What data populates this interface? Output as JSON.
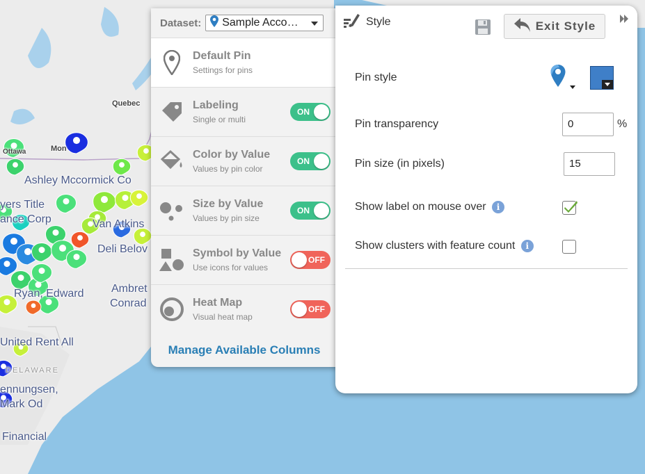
{
  "map": {
    "labels": {
      "quebec": "Quebec",
      "ottawa": "Ottawa",
      "montreal": "Mon",
      "ashley": "Ashley Mccormick Co",
      "ayers": "yers Title",
      "ance": "ance Corp",
      "vanatkins": "Van Atkins",
      "delibelov": "Deli Belov",
      "ryan": "Ryan, Edward",
      "ambret": "Ambret",
      "conrad": "Conrad",
      "unitedrent": "United Rent All",
      "delaware": "DELAWARE",
      "ennungsen": "ennungsen,",
      "markod": "Mark Od",
      "financial": "Financial"
    }
  },
  "dataset": {
    "label": "Dataset:",
    "selected": "Sample Acco…"
  },
  "layers": [
    {
      "title": "Default Pin",
      "subtitle": "Settings for pins",
      "icon": "pin-icon",
      "toggle": null
    },
    {
      "title": "Labeling",
      "subtitle": "Single or multi",
      "icon": "tag-icon",
      "toggle": "ON"
    },
    {
      "title": "Color by Value",
      "subtitle": "Values by pin color",
      "icon": "paint-bucket-icon",
      "toggle": "ON"
    },
    {
      "title": "Size by Value",
      "subtitle": "Values by pin size",
      "icon": "size-dots-icon",
      "toggle": "ON"
    },
    {
      "title": "Symbol by Value",
      "subtitle": "Use icons for values",
      "icon": "shapes-icon",
      "toggle": "OFF"
    },
    {
      "title": "Heat Map",
      "subtitle": "Visual heat map",
      "icon": "heatmap-icon",
      "toggle": "OFF"
    }
  ],
  "manage_columns": "Manage Available Columns",
  "style_panel": {
    "title": "Style",
    "exit_label": "Exit Style",
    "pin_style_label": "Pin style",
    "pin_color": "#3f7fc8",
    "transparency_label": "Pin transparency",
    "transparency_value": "0",
    "transparency_unit": "%",
    "size_label": "Pin size (in pixels)",
    "size_value": "15",
    "show_label_text": "Show label on mouse over",
    "show_label_checked": true,
    "clusters_text": "Show clusters with feature count",
    "clusters_checked": false,
    "info_glyph": "i"
  }
}
